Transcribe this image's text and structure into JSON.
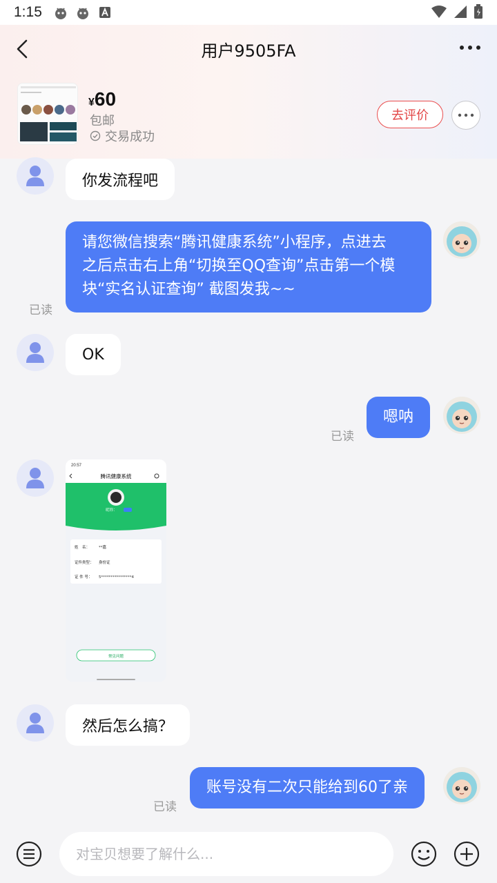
{
  "status_bar": {
    "time": "1:15"
  },
  "header": {
    "title": "用户9505FA"
  },
  "product": {
    "currency": "¥",
    "price": "60",
    "shipping": "包邮",
    "deal_status": "交易成功",
    "review_label": "去评价"
  },
  "messages": [
    {
      "side": "in",
      "text": "你发流程吧"
    },
    {
      "side": "out",
      "lines": [
        "请您微信搜索“腾讯健康系统”小程序，点进去",
        "之后点击右上角“切换至QQ查询”点击第一个模",
        "块“实名认证查询” 截图发我~~"
      ],
      "read": "已读"
    },
    {
      "side": "in",
      "text": "OK"
    },
    {
      "side": "out",
      "text": "嗯呐",
      "read": "已读"
    },
    {
      "side": "in",
      "type": "image"
    },
    {
      "side": "in",
      "text": "然后怎么搞？"
    },
    {
      "side": "out",
      "text": "账号没有二次只能给到60了亲",
      "read": "已读"
    }
  ],
  "screenshot": {
    "time": "20:57",
    "title": "腾讯健康系统",
    "nickname": "昵称：",
    "rows": [
      {
        "label": "姓　名：",
        "value": "**嘉"
      },
      {
        "label": "证件类型：",
        "value": "身份证"
      },
      {
        "label": "证 件 号：",
        "value": "5****************4"
      }
    ],
    "faq": "常见问题"
  },
  "input": {
    "placeholder": "对宝贝想要了解什么..."
  },
  "colors": {
    "accent": "#4e7cf6",
    "review": "#e24646"
  }
}
